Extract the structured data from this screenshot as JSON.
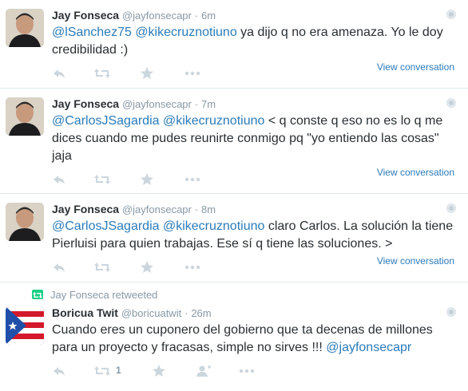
{
  "tweets": [
    {
      "fullname": "Jay Fonseca",
      "username": "@jayfonsecapr",
      "separator": "·",
      "time": "6m",
      "mentions": [
        "@lSanchez75",
        "@kikecruznotiuno"
      ],
      "text_after": " ya dijo q no era amenaza. Yo le doy credibilidad :)",
      "view_conversation": "View conversation"
    },
    {
      "fullname": "Jay Fonseca",
      "username": "@jayfonsecapr",
      "separator": "·",
      "time": "7m",
      "mentions": [
        "@CarlosJSagardia",
        "@kikecruznotiuno"
      ],
      "text_after": " < q conste q eso no es lo q me dices cuando me pudes reunirte conmigo pq \"yo entiendo las cosas\" jaja",
      "view_conversation": "View conversation"
    },
    {
      "fullname": "Jay Fonseca",
      "username": "@jayfonsecapr",
      "separator": "·",
      "time": "8m",
      "mentions": [
        "@CarlosJSagardia",
        "@kikecruznotiuno"
      ],
      "text_after": " claro Carlos. La solución la tiene Pierluisi para quien trabajas. Ese sí q tiene las soluciones. >",
      "view_conversation": "View conversation"
    },
    {
      "retweet_context": "Jay Fonseca retweeted",
      "fullname": "Boricua Twit",
      "username": "@boricuatwit",
      "separator": "·",
      "time": "26m",
      "text_before": "Cuando eres un cuponero del gobierno que ta decenas de millones para un proyecto y fracasas, simple no sirves !!! ",
      "mention_end": "@jayfonsecapr",
      "retweet_count": "1"
    }
  ],
  "icons": {
    "reply": "reply-icon",
    "retweet": "retweet-icon",
    "favorite": "star-icon",
    "more": "more-icon",
    "follow": "follow-icon",
    "gear": "gear-icon"
  },
  "colors": {
    "link": "#2b7bb9",
    "muted": "#8899a6",
    "icon": "#ccd6dd",
    "retweet_badge": "#19cf86"
  }
}
